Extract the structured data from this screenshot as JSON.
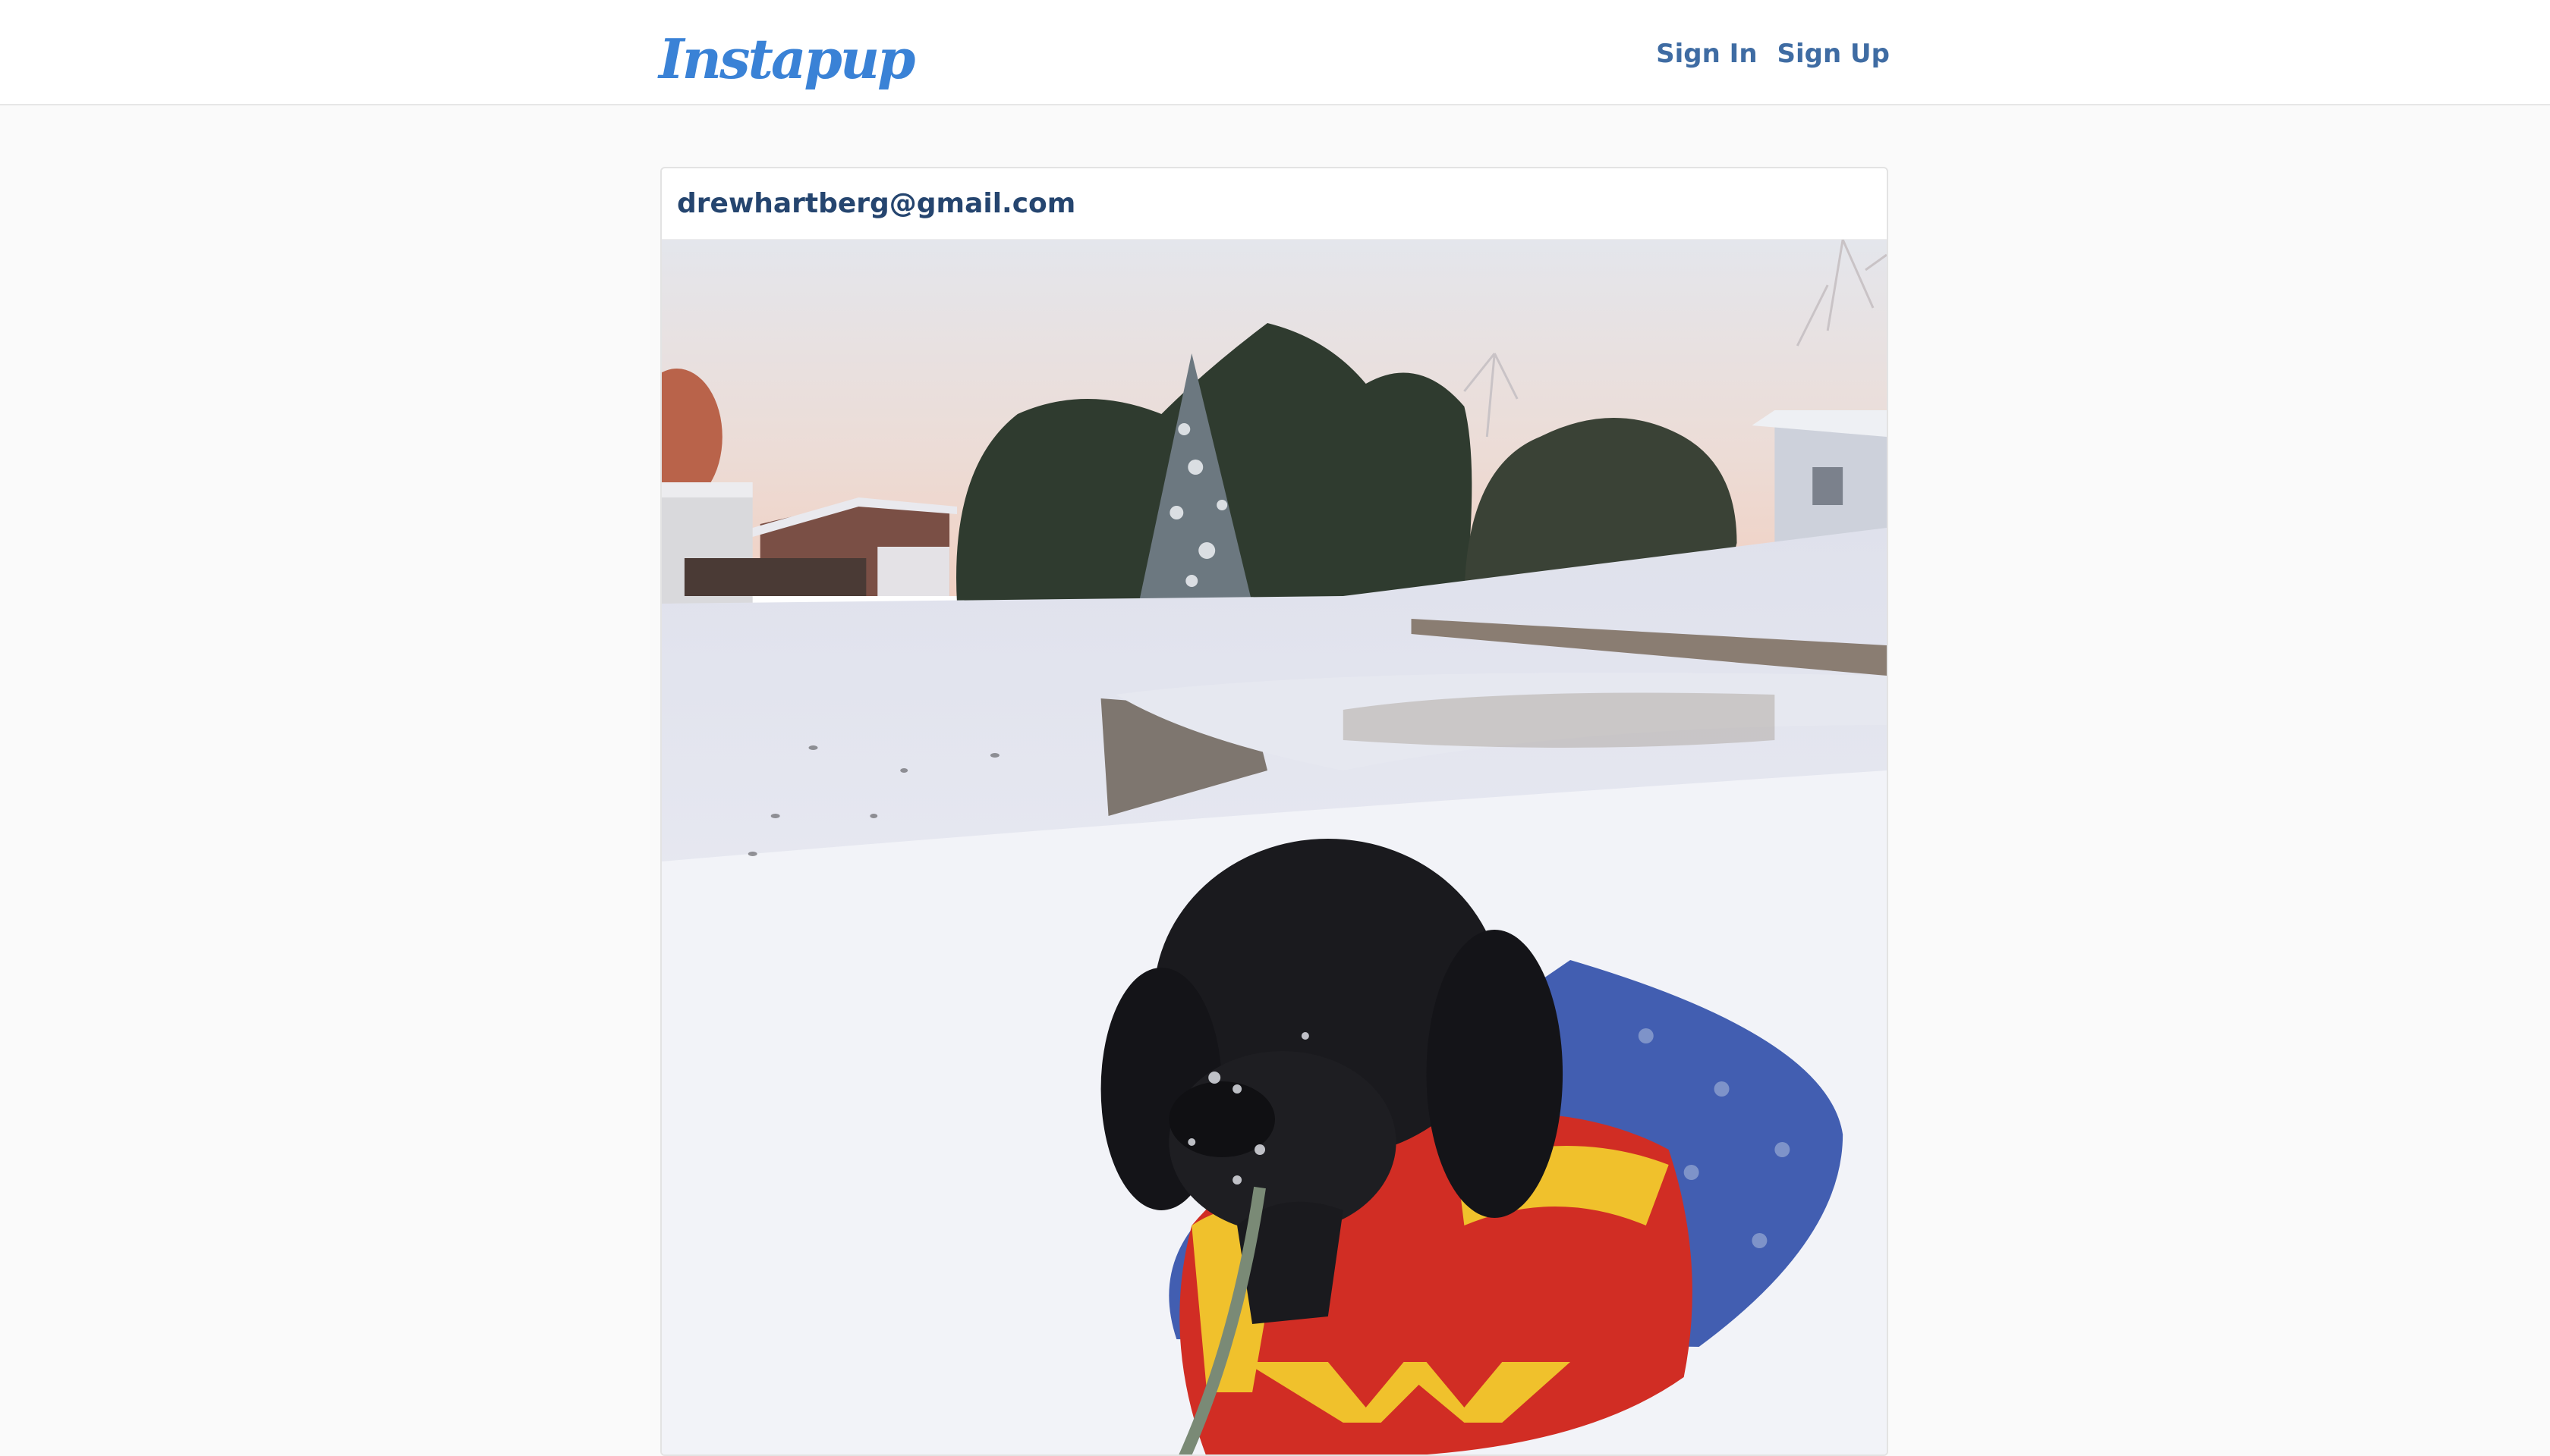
{
  "navbar": {
    "brand": "Instapup",
    "links": [
      {
        "label": "Sign In"
      },
      {
        "label": "Sign Up"
      }
    ]
  },
  "post": {
    "username": "drewhartberg@gmail.com",
    "photo_alt": "Black dog in Wonder Woman costume in the snow"
  },
  "colors": {
    "brand": "#3a82d6",
    "nav_link": "#3f6ca3",
    "username": "#25456f",
    "background": "#fafafa"
  }
}
